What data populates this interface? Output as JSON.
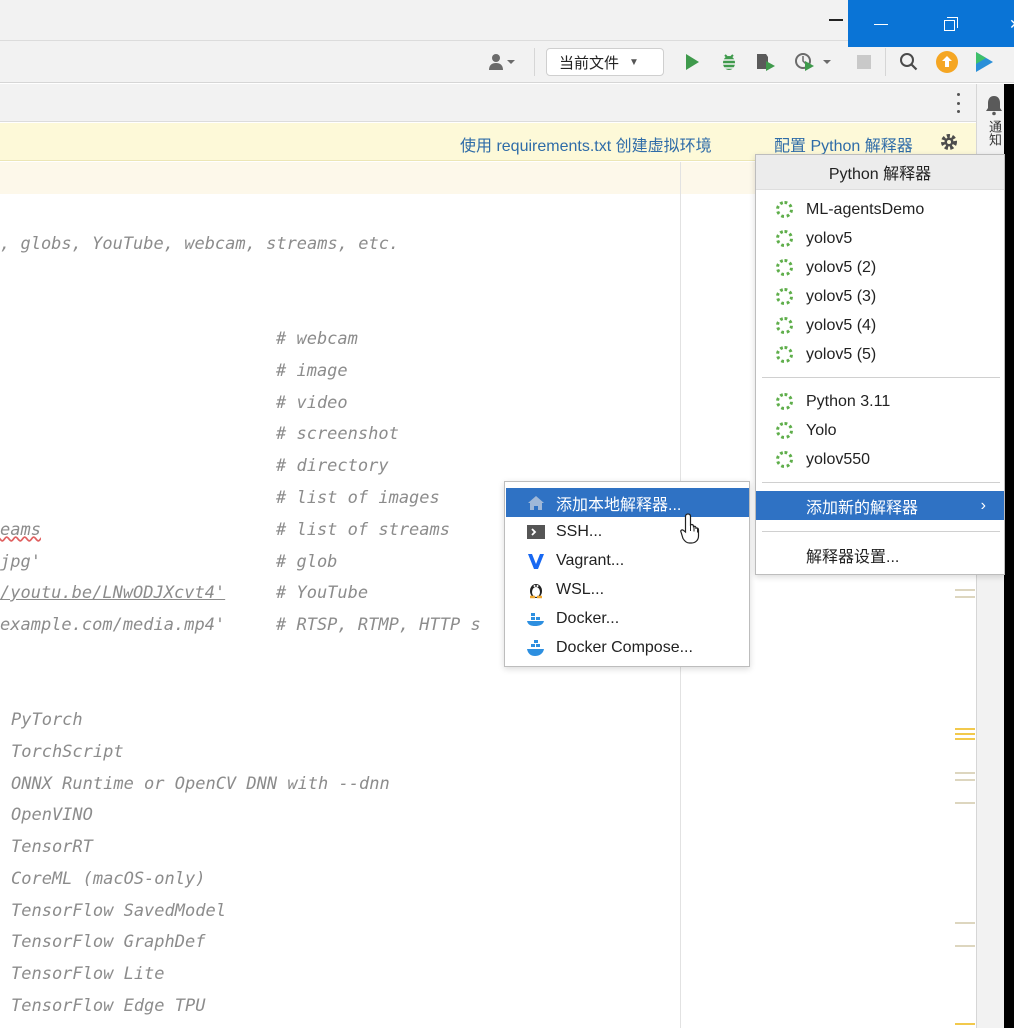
{
  "window": {
    "controls": {
      "minimize": "minimize",
      "restore": "restore",
      "close": "close"
    }
  },
  "toolbar": {
    "run_config": "当前文件",
    "icons": [
      "user-icon",
      "run-icon",
      "debug-icon",
      "coverage-icon",
      "profile-icon",
      "stop-icon",
      "search-icon",
      "update-icon",
      "plugin-icon"
    ]
  },
  "right_strip": {
    "notifications_label": "通知"
  },
  "banner": {
    "create_venv": "使用 requirements.txt 创建虚拟环境",
    "configure_interpreter": "配置 Python 解释器"
  },
  "editor": {
    "lines": [
      {
        "text": ", globs, YouTube, webcam, streams, etc."
      },
      {
        "text": "# webcam"
      },
      {
        "text": "# image"
      },
      {
        "text": "# video"
      },
      {
        "text": "# screenshot"
      },
      {
        "text": "# directory"
      },
      {
        "text": "# list of images"
      },
      {
        "code": "eams",
        "comment": "# list of streams"
      },
      {
        "code": "jpg'",
        "comment": "# glob"
      },
      {
        "code": "/youtu.be/LNwODJXcvt4'",
        "comment": "# YouTube"
      },
      {
        "code": "example.com/media.mp4'",
        "comment": "# RTSP, RTMP, HTTP s"
      },
      {
        "text": "PyTorch"
      },
      {
        "text": "TorchScript"
      },
      {
        "text": "ONNX Runtime or OpenCV DNN with --dnn"
      },
      {
        "text": "OpenVINO"
      },
      {
        "text": "TensorRT"
      },
      {
        "text": "CoreML (macOS-only)"
      },
      {
        "text": "TensorFlow SavedModel"
      },
      {
        "text": "TensorFlow GraphDef"
      },
      {
        "text": "TensorFlow Lite"
      },
      {
        "text": "TensorFlow Edge TPU"
      }
    ]
  },
  "interpreter_popup": {
    "title": "Python 解释器",
    "group1": [
      "ML-agentsDemo",
      "yolov5",
      "yolov5 (2)",
      "yolov5 (3)",
      "yolov5 (4)",
      "yolov5 (5)"
    ],
    "group2": [
      "Python 3.11",
      "Yolo",
      "yolov550"
    ],
    "add_new": "添加新的解释器",
    "settings": "解释器设置..."
  },
  "add_submenu": {
    "items": [
      {
        "label": "添加本地解释器...",
        "icon": "home-icon",
        "selected": true
      },
      {
        "label": "SSH...",
        "icon": "terminal-icon"
      },
      {
        "label": "Vagrant...",
        "icon": "vagrant-icon"
      },
      {
        "label": "WSL...",
        "icon": "linux-icon"
      },
      {
        "label": "Docker...",
        "icon": "docker-icon"
      },
      {
        "label": "Docker Compose...",
        "icon": "docker-compose-icon"
      }
    ]
  },
  "colors": {
    "accent_blue": "#2f72c4",
    "window_blue": "#0a74d6",
    "banner_bg": "#fdf9d8",
    "link": "#2f6ca8",
    "run_green": "#3f9a4c",
    "interpreter_ring": "#5fae4b"
  }
}
